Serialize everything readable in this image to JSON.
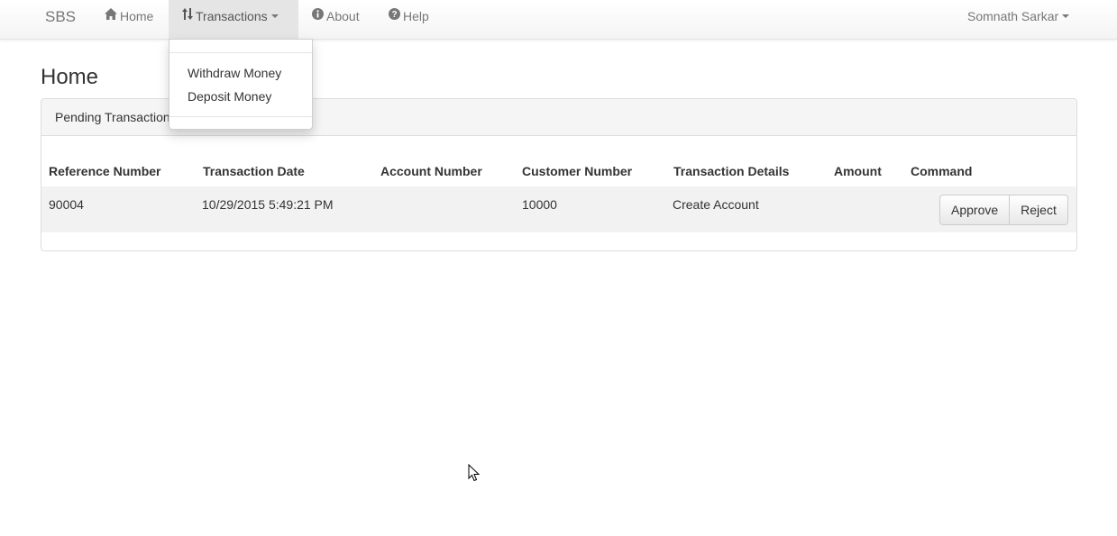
{
  "navbar": {
    "brand": "SBS",
    "items": [
      {
        "label": "Home",
        "icon": "home-icon"
      },
      {
        "label": "Transactions",
        "icon": "sort-arrows-icon"
      },
      {
        "label": "About",
        "icon": "info-circle-icon"
      },
      {
        "label": "Help",
        "icon": "question-circle-icon"
      }
    ],
    "user": "Somnath Sarkar"
  },
  "dropdown": {
    "items": [
      "Withdraw Money",
      "Deposit Money"
    ]
  },
  "page": {
    "title": "Home"
  },
  "panel": {
    "heading": "Pending Transactions"
  },
  "table": {
    "headers": [
      "Reference Number",
      "Transaction Date",
      "Account Number",
      "Customer Number",
      "Transaction Details",
      "Amount",
      "Command"
    ],
    "rows": [
      {
        "reference_number": "90004",
        "transaction_date": "10/29/2015 5:49:21 PM",
        "account_number": "",
        "customer_number": "10000",
        "transaction_details": "Create Account",
        "amount": "",
        "approve_label": "Approve",
        "reject_label": "Reject"
      }
    ]
  },
  "colors": {
    "navbar_text": "#777777",
    "active_tab_bg": "#e5e5e5",
    "panel_heading_bg": "#f5f5f5",
    "row_bg": "#f2f2f2"
  }
}
